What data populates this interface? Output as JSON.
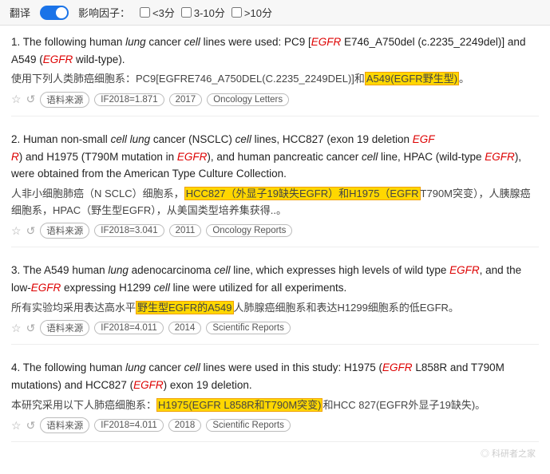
{
  "topbar": {
    "translate_label": "翻译",
    "toggle_state": "on",
    "filter_label": "影响因子：",
    "filters": [
      {
        "label": "<3分",
        "checked": false
      },
      {
        "label": "3-10分",
        "checked": false
      },
      {
        ">10分": ">10分",
        "label": ">10分",
        "checked": false
      }
    ]
  },
  "results": [
    {
      "num": "1.",
      "en_parts": [
        {
          "text": "The following human ",
          "style": "normal"
        },
        {
          "text": "lung",
          "style": "italic"
        },
        {
          "text": " cancer ",
          "style": "normal"
        },
        {
          "text": "cell",
          "style": "italic"
        },
        {
          "text": " lines were used: PC9 [",
          "style": "normal"
        },
        {
          "text": "EGFR",
          "style": "egfr"
        },
        {
          "text": " E746_A750del (c.2235_2249del)] and A549 (",
          "style": "normal"
        },
        {
          "text": "EGFR",
          "style": "egfr"
        },
        {
          "text": " wild-type).",
          "style": "normal"
        }
      ],
      "zh_parts": [
        {
          "text": "使用下列人类肺癌细胞系：PC9[EGFRE746_A750DEL(C.2235_2249DEL)]和",
          "style": "normal"
        },
        {
          "text": "A549(EGFR野生型)。",
          "style": "highlight"
        }
      ],
      "meta": {
        "source_label": "语料来源",
        "if_label": "IF2018=1.871",
        "year": "2017",
        "journal": "Oncology Letters"
      }
    },
    {
      "num": "2.",
      "en_parts": [
        {
          "text": "Human non-small ",
          "style": "normal"
        },
        {
          "text": "cell lung",
          "style": "italic"
        },
        {
          "text": " cancer (NSCLC) ",
          "style": "normal"
        },
        {
          "text": "cell",
          "style": "italic"
        },
        {
          "text": " lines, HCC827 (exon 19 deletion ",
          "style": "normal"
        },
        {
          "text": "EGF\nR",
          "style": "egfr"
        },
        {
          "text": ") and H1975 (T790M mutation in ",
          "style": "normal"
        },
        {
          "text": "EGFR",
          "style": "egfr"
        },
        {
          "text": "), and human pancreatic cancer ",
          "style": "normal"
        },
        {
          "text": "cell",
          "style": "italic"
        },
        {
          "text": " line, HPAC (wild-type ",
          "style": "normal"
        },
        {
          "text": "EGFR",
          "style": "egfr"
        },
        {
          "text": "), were obtained from the American Type Culture Collection.",
          "style": "normal"
        }
      ],
      "zh_parts": [
        {
          "text": "人非小细胞肺癌（N SCLC）细胞系，",
          "style": "normal"
        },
        {
          "text": "HCC827（外显子19缺失EGFR）和H1975（EGFR",
          "style": "highlight"
        },
        {
          "text": "T790M突变），人胰腺癌细胞系，HPAC（野生型EGFR），从美国类型培养集获得..。",
          "style": "normal"
        }
      ],
      "meta": {
        "source_label": "语料来源",
        "if_label": "IF2018=3.041",
        "year": "2011",
        "journal": "Oncology Reports"
      }
    },
    {
      "num": "3.",
      "en_parts": [
        {
          "text": "The A549 human ",
          "style": "normal"
        },
        {
          "text": "lung",
          "style": "italic"
        },
        {
          "text": " adenocarcinoma ",
          "style": "normal"
        },
        {
          "text": "cell",
          "style": "italic"
        },
        {
          "text": " line, which expresses high levels of wild type ",
          "style": "normal"
        },
        {
          "text": "EGFR",
          "style": "egfr"
        },
        {
          "text": ", and the low-",
          "style": "normal"
        },
        {
          "text": "EGFR",
          "style": "egfr"
        },
        {
          "text": " expressing H1299 ",
          "style": "normal"
        },
        {
          "text": "cell",
          "style": "italic"
        },
        {
          "text": " line were utilized for all experiments.",
          "style": "normal"
        }
      ],
      "zh_parts": [
        {
          "text": "所有实验均采用表达高水平",
          "style": "normal"
        },
        {
          "text": "野生型EGFR的A549",
          "style": "highlight"
        },
        {
          "text": "人肺腺癌细胞系和表达H1299细胞系的低EGFR。",
          "style": "normal"
        }
      ],
      "meta": {
        "source_label": "语料来源",
        "if_label": "IF2018=4.011",
        "year": "2014",
        "journal": "Scientific Reports"
      }
    },
    {
      "num": "4.",
      "en_parts": [
        {
          "text": "The following human ",
          "style": "normal"
        },
        {
          "text": "lung",
          "style": "italic"
        },
        {
          "text": " cancer ",
          "style": "normal"
        },
        {
          "text": "cell",
          "style": "italic"
        },
        {
          "text": " lines were used in this study: H1975 (",
          "style": "normal"
        },
        {
          "text": "EGFR",
          "style": "egfr"
        },
        {
          "text": " L858R and T790M mutations) and HCC827 (",
          "style": "normal"
        },
        {
          "text": "EGFR",
          "style": "egfr"
        },
        {
          "text": ") exon 19 deletion.",
          "style": "normal"
        }
      ],
      "zh_parts": [
        {
          "text": "本研究采用以下人肺癌细胞系：",
          "style": "normal"
        },
        {
          "text": "H1975(EGFR L858R和T790M突变)",
          "style": "highlight"
        },
        {
          "text": "和HCC 827(EGFR外显子19缺失)。",
          "style": "normal"
        }
      ],
      "meta": {
        "source_label": "语料来源",
        "if_label": "IF2018=4.011",
        "year": "2018",
        "journal": "Scientific Reports"
      }
    }
  ],
  "watermark": "◎ 科研者之家"
}
